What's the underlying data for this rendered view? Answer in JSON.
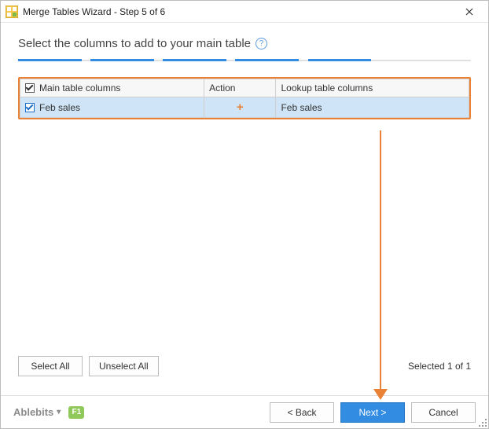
{
  "titlebar": {
    "title": "Merge Tables Wizard - Step 5 of 6"
  },
  "heading": "Select the columns to add to your main table",
  "table": {
    "headers": {
      "main": "Main table columns",
      "action": "Action",
      "lookup": "Lookup table columns"
    },
    "rows": [
      {
        "main": "Feb sales",
        "action": "+",
        "lookup": "Feb sales",
        "checked": true
      }
    ]
  },
  "buttons": {
    "select_all": "Select All",
    "unselect_all": "Unselect All",
    "back": "< Back",
    "next": "Next >",
    "cancel": "Cancel"
  },
  "status": {
    "selected": "Selected 1 of 1"
  },
  "footer": {
    "brand": "Ablebits",
    "f1": "F1"
  }
}
